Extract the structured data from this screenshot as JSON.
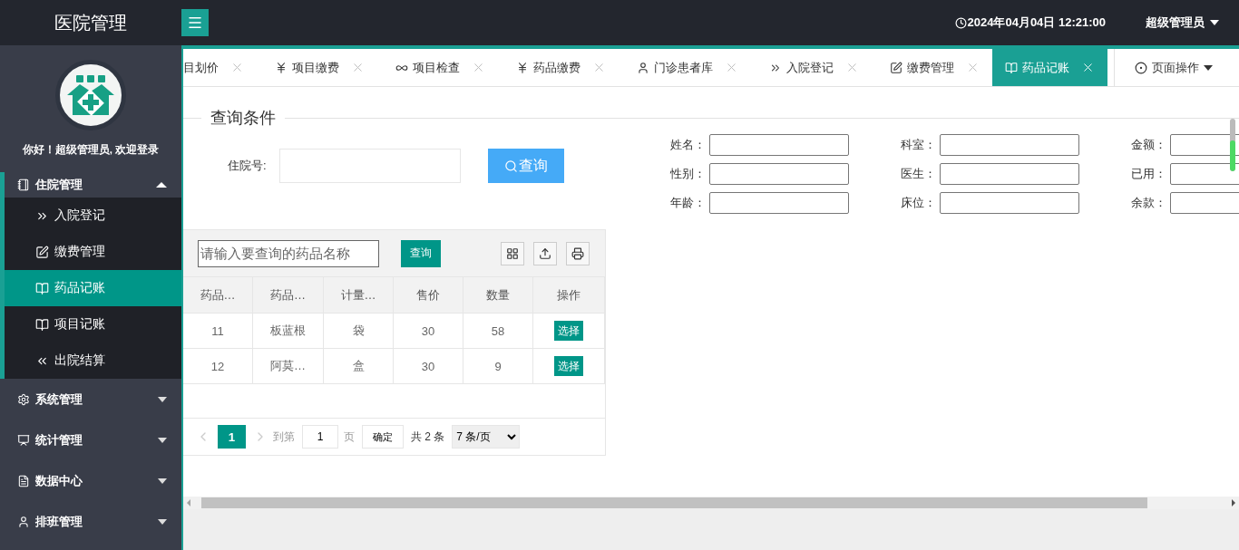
{
  "header": {
    "title": "医院管理",
    "datetime": "2024年04月04日 12:21:00",
    "user": "超级管理员"
  },
  "sidebar": {
    "greeting": "你好！超级管理员, 欢迎登录",
    "menu": [
      {
        "label": "住院管理",
        "expanded": true,
        "children": [
          {
            "label": "入院登记",
            "selected": false
          },
          {
            "label": "缴费管理",
            "selected": false
          },
          {
            "label": "药品记账",
            "selected": true
          },
          {
            "label": "项目记账",
            "selected": false
          },
          {
            "label": "出院结算",
            "selected": false
          }
        ]
      },
      {
        "label": "系统管理",
        "expanded": false
      },
      {
        "label": "统计管理",
        "expanded": false
      },
      {
        "label": "数据中心",
        "expanded": false
      },
      {
        "label": "排班管理",
        "expanded": false
      }
    ]
  },
  "tabs": [
    {
      "label": "目划价",
      "selected": false
    },
    {
      "label": "项目缴费",
      "selected": false
    },
    {
      "label": "项目检查",
      "selected": false
    },
    {
      "label": "药品缴费",
      "selected": false
    },
    {
      "label": "门诊患者库",
      "selected": false
    },
    {
      "label": "入院登记",
      "selected": false
    },
    {
      "label": "缴费管理",
      "selected": false
    },
    {
      "label": "药品记账",
      "selected": true
    }
  ],
  "page_ops": "页面操作",
  "query": {
    "legend": "查询条件",
    "label": "住院号:",
    "button": "查询"
  },
  "patient_fields": [
    "姓名：",
    "科室：",
    "金额：",
    "性别：",
    "医生：",
    "已用：",
    "年龄：",
    "床位：",
    "余款："
  ],
  "drug_table": {
    "search_placeholder": "请输入要查询的药品名称",
    "search_button": "查询",
    "columns": [
      "药品…",
      "药品…",
      "计量…",
      "售价",
      "数量",
      "操作"
    ],
    "rows": [
      {
        "cells": [
          "11",
          "板蓝根",
          "袋",
          "30",
          "58"
        ],
        "action": "选择"
      },
      {
        "cells": [
          "12",
          "阿莫…",
          "盒",
          "30",
          "9"
        ],
        "action": "选择"
      }
    ],
    "pagination": {
      "pages": [
        {
          "label": "1",
          "selected": true
        }
      ],
      "goto_label": "到第",
      "goto_value": "1",
      "page_unit": "页",
      "confirm": "确定",
      "total": "共 2 条",
      "page_size": "7 条/页"
    }
  }
}
